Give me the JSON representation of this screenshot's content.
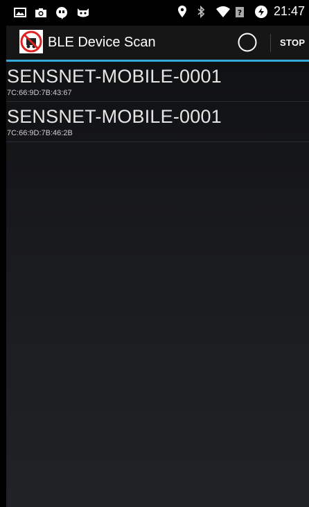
{
  "status_bar": {
    "left_icons": [
      "gallery-icon",
      "camera-icon",
      "hangouts-icon",
      "cyanogenmod-icon"
    ],
    "right_icons": [
      "location-icon",
      "bluetooth-icon",
      "wifi-icon",
      "no-sim-icon",
      "data-saver-icon"
    ],
    "time": "21:47"
  },
  "action_bar": {
    "title": "BLE Device Scan",
    "stop_label": "STOP",
    "accent_color": "#35a9d9"
  },
  "devices": [
    {
      "name": "SENSNET-MOBILE-0001",
      "address": "7C:66:9D:7B:43:67"
    },
    {
      "name": "SENSNET-MOBILE-0001",
      "address": "7C:66:9D:7B:46:2B"
    }
  ]
}
